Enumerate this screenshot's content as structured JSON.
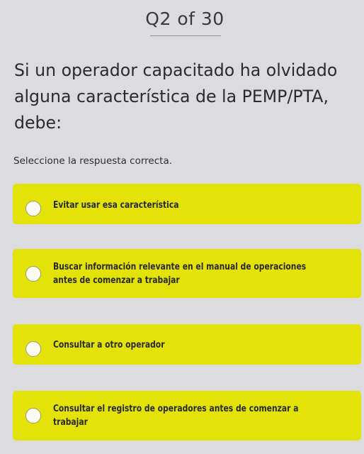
{
  "quiz": {
    "counter": "Q2 of 30",
    "question": "Si un operador capacitado ha olvidado alguna característica de la PEMP/PTA, debe:",
    "instruction": "Seleccione la respuesta correcta.",
    "options": [
      {
        "label": "Evitar usar esa característica",
        "selected": false
      },
      {
        "label": "Buscar información relevante en el manual de operaciones antes de comenzar a trabajar",
        "selected": false
      },
      {
        "label": "Consultar a otro operador",
        "selected": false
      },
      {
        "label": "Consultar el registro de operadores antes de comenzar a trabajar",
        "selected": false
      }
    ]
  },
  "colors": {
    "background": "#dcdcde",
    "option_fill": "#e3e30a",
    "text": "#2a2a2c"
  },
  "icons": {
    "option_marker": "radio-button-icon"
  }
}
